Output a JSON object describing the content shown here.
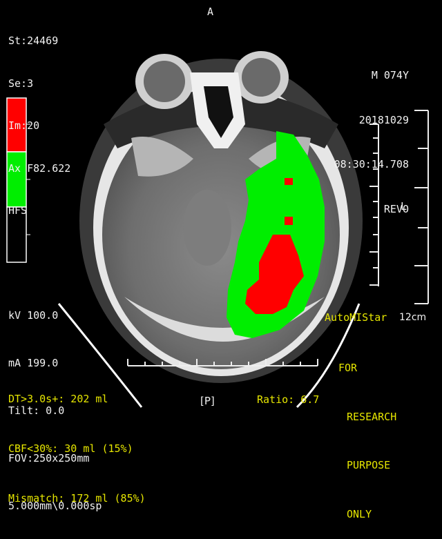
{
  "info_top_left": [
    "St:24469",
    "Se:3",
    "Im:20",
    "Ax F82.622",
    "HFS"
  ],
  "orientation": {
    "top": "A",
    "right": "L",
    "bottom": "[P]"
  },
  "info_top_right": [
    "M 074Y",
    "20181029",
    "08:30:14.708",
    "REVO"
  ],
  "info_bottom_left": [
    "kV 100.0",
    "mA 199.0",
    "Tilt: 0.0",
    "FOV:250x250mm",
    "5.000mm\\0.000sp"
  ],
  "stats": {
    "dt": "DT>3.0s+: 202 ml",
    "cbf": "CBF<30%: 30 ml (15%)",
    "mismatch": "Mismatch: 172 ml (85%)",
    "ratio": "Ratio: 6.7"
  },
  "brand": "AutoMIStar",
  "scale_label": "12cm",
  "disclaimer": [
    "FOR",
    "RESEARCH",
    "PURPOSE",
    "ONLY"
  ],
  "colors": {
    "core": "#ff0000",
    "penumbra": "#00ee00",
    "overlay_text": "#e6e600"
  }
}
